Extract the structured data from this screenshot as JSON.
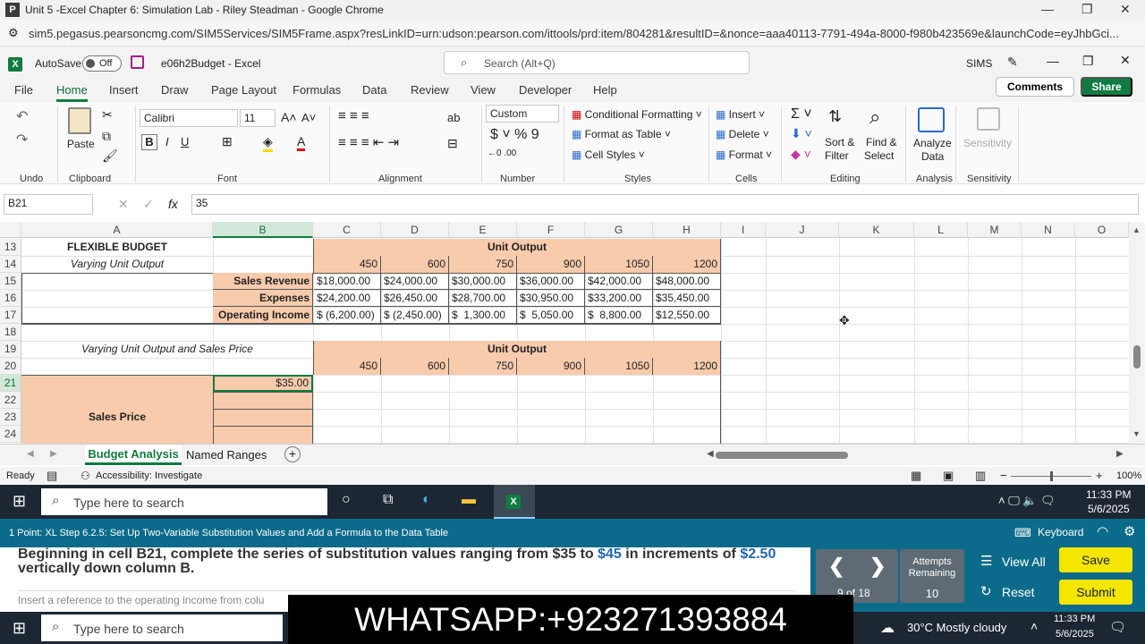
{
  "browser": {
    "title": "Unit 5 -Excel Chapter 6: Simulation Lab - Riley Steadman - Google Chrome",
    "url": "sim5.pegasus.pearsoncmg.com/SIM5Services/SIM5Frame.aspx?resLinkID=urn:udson:pearson.com/ittools/prd:item/804281&resultID=&nonce=aaa40113-7791-494a-8000-f980b423569e&launchCode=eyJhbGci..."
  },
  "excel": {
    "autosave_label": "AutoSave",
    "autosave_state": "Off",
    "filename": "e06h2Budget - Excel",
    "search_placeholder": "Search (Alt+Q)",
    "user": "SIMS",
    "comments": "Comments",
    "share": "Share"
  },
  "menu": [
    "File",
    "Home",
    "Insert",
    "Draw",
    "Page Layout",
    "Formulas",
    "Data",
    "Review",
    "View",
    "Developer",
    "Help"
  ],
  "ribbon": {
    "groups": [
      "Undo",
      "Clipboard",
      "Font",
      "Alignment",
      "Number",
      "Styles",
      "Cells",
      "Editing",
      "Analysis",
      "Sensitivity"
    ],
    "paste": "Paste",
    "font": "Calibri",
    "size": "11",
    "numfmt": "Custom",
    "cond": "Conditional Formatting",
    "fmt_table": "Format as Table",
    "cell_styles": "Cell Styles",
    "insert": "Insert",
    "delete": "Delete",
    "format": "Format",
    "sort": "Sort &",
    "filter": "Filter",
    "find": "Find &",
    "select": "Select",
    "analyze": "Analyze",
    "data": "Data",
    "sens": "Sensitivity"
  },
  "formula": {
    "namebox": "B21",
    "fx": "fx",
    "value": "35"
  },
  "columns": [
    "A",
    "B",
    "C",
    "D",
    "E",
    "F",
    "G",
    "H",
    "I",
    "J",
    "K",
    "L",
    "M",
    "N",
    "O"
  ],
  "rows": [
    "13",
    "14",
    "15",
    "16",
    "17",
    "18",
    "19",
    "20",
    "21",
    "22",
    "23",
    "24"
  ],
  "sheet": {
    "a13": "FLEXIBLE BUDGET",
    "a14": "Varying Unit Output",
    "unit_output": "Unit Output",
    "outputs": [
      "450",
      "600",
      "750",
      "900",
      "1050",
      "1200"
    ],
    "labels": [
      "Sales Revenue",
      "Expenses",
      "Operating Income"
    ],
    "revenue": [
      "$18,000.00",
      "$24,000.00",
      "$30,000.00",
      "$36,000.00",
      "$42,000.00",
      "$48,000.00"
    ],
    "expenses": [
      "$24,200.00",
      "$26,450.00",
      "$28,700.00",
      "$30,950.00",
      "$33,200.00",
      "$35,450.00"
    ],
    "income": [
      "$ (6,200.00)",
      "$ (2,450.00)",
      "$  1,300.00",
      "$  5,050.00",
      "$  8,800.00",
      "$12,550.00"
    ],
    "a19": "Varying Unit Output and Sales Price",
    "b21": "$35.00",
    "a23": "Sales Price"
  },
  "tabs": {
    "active": "Budget Analysis",
    "other": "Named Ranges"
  },
  "status": {
    "ready": "Ready",
    "access": "Accessibility: Investigate",
    "zoom": "100%"
  },
  "taskbar": {
    "search": "Type here to search",
    "time": "11:33 PM",
    "date": "5/6/2025",
    "weather": "30°C  Mostly cloudy"
  },
  "sim": {
    "step": "1 Point: XL Step 6.2.5: Set Up Two-Variable Substitution Values and Add a Formula to the Data Table",
    "keyboard": "Keyboard",
    "instr_a": "Beginning in cell B21, complete the series of substitution values ranging from $35 to ",
    "instr_b": "$45",
    "instr_c": " in increments of",
    "instr_d": "$2.50",
    "instr_e": " vertically down column B.",
    "instr2": "Insert a reference to the operating income from colu",
    "page": "9 of 18",
    "attempts": "Attempts Remaining",
    "attempts_n": "10",
    "viewall": "View All",
    "reset": "Reset",
    "save": "Save",
    "submit": "Submit"
  },
  "overlay": "WHATSAPP:+923271393884"
}
